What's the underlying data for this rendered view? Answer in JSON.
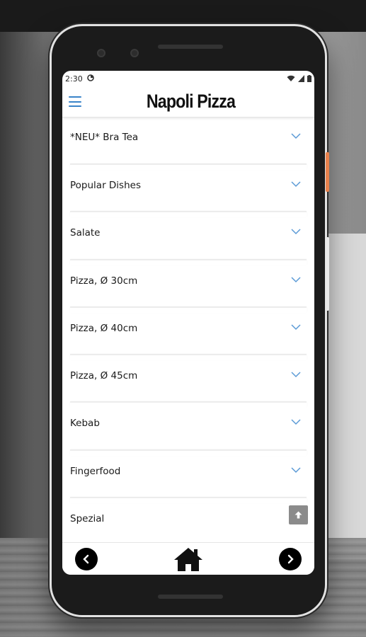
{
  "status_bar": {
    "time": "2:30"
  },
  "app": {
    "title": "Napoli Pizza"
  },
  "menu": {
    "items": [
      {
        "label": "*NEU* Bra Tea"
      },
      {
        "label": "Popular Dishes"
      },
      {
        "label": "Salate"
      },
      {
        "label": "Pizza, Ø 30cm"
      },
      {
        "label": "Pizza, Ø 40cm"
      },
      {
        "label": "Pizza, Ø 45cm"
      },
      {
        "label": "Kebab"
      },
      {
        "label": "Fingerfood"
      },
      {
        "label": "Spezial"
      }
    ]
  },
  "colors": {
    "accent": "#3a84c9",
    "chevron": "#5b9ad6",
    "scroll_top_button": "#8b8b8b"
  },
  "icons": {
    "menu": "hamburger-icon",
    "expand": "chevron-down-icon",
    "scroll_top": "arrow-up-icon",
    "back": "chevron-left-icon",
    "home": "home-icon",
    "forward": "chevron-right-icon"
  }
}
